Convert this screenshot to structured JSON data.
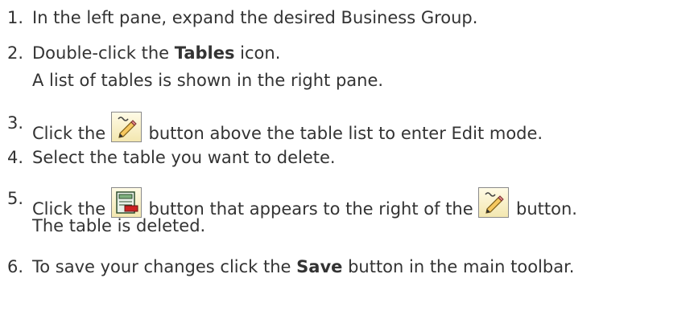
{
  "steps": [
    {
      "num": "1.",
      "text": "In the left pane, expand the desired Business Group."
    },
    {
      "num": "2.",
      "pre": "Double-click the ",
      "bold": "Tables",
      "post": " icon."
    },
    {
      "cont": "A list of tables is shown in the right pane."
    },
    {
      "num": "3.",
      "pre": "Click the ",
      "post": " button above the table list to enter Edit mode."
    },
    {
      "num": "4.",
      "text": "Select the table you want to delete."
    },
    {
      "num": "5.",
      "pre": "Click the ",
      "mid": " button that appears to the right of the ",
      "post": " button."
    },
    {
      "cont": "The table is deleted."
    },
    {
      "num": "6.",
      "pre": "To save your changes click the ",
      "bold": "Save",
      "post": " button in the main toolbar."
    }
  ],
  "icons": {
    "edit": "edit-pencil-icon",
    "delete": "delete-table-icon"
  },
  "colors": {
    "text": "#333333",
    "icon_bg": "#f3e7b0",
    "delete_red": "#cc2222"
  }
}
